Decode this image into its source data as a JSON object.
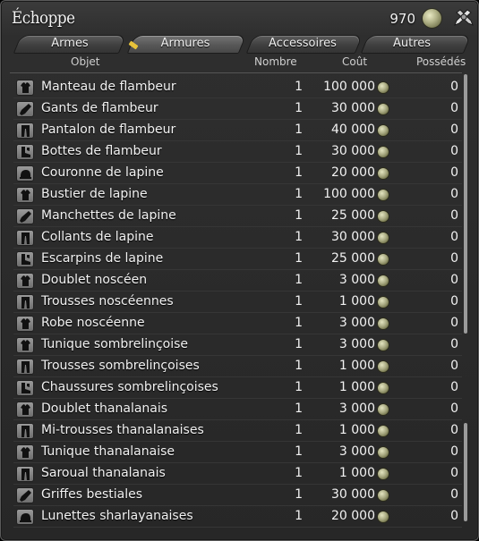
{
  "window": {
    "title": "Échoppe"
  },
  "currency": {
    "amount": "970",
    "icon": "gil-coin-icon"
  },
  "tabs": [
    {
      "label": "Armes",
      "active": false
    },
    {
      "label": "Armures",
      "active": true
    },
    {
      "label": "Accessoires",
      "active": false
    },
    {
      "label": "Autres",
      "active": false
    }
  ],
  "columns": {
    "object": "Objet",
    "quantity": "Nombre",
    "cost": "Coût",
    "owned": "Possédés"
  },
  "items": [
    {
      "icon": "body-armor-icon",
      "name": "Manteau de flambeur",
      "qty": "1",
      "cost": "100 000",
      "owned": "0"
    },
    {
      "icon": "gloves-icon",
      "name": "Gants de flambeur",
      "qty": "1",
      "cost": "30 000",
      "owned": "0"
    },
    {
      "icon": "legs-icon",
      "name": "Pantalon de flambeur",
      "qty": "1",
      "cost": "40 000",
      "owned": "0"
    },
    {
      "icon": "feet-icon",
      "name": "Bottes de flambeur",
      "qty": "1",
      "cost": "30 000",
      "owned": "0"
    },
    {
      "icon": "head-icon",
      "name": "Couronne de lapine",
      "qty": "1",
      "cost": "20 000",
      "owned": "0"
    },
    {
      "icon": "body-armor-icon",
      "name": "Bustier de lapine",
      "qty": "1",
      "cost": "100 000",
      "owned": "0"
    },
    {
      "icon": "gloves-icon",
      "name": "Manchettes de lapine",
      "qty": "1",
      "cost": "25 000",
      "owned": "0"
    },
    {
      "icon": "legs-icon",
      "name": "Collants de lapine",
      "qty": "1",
      "cost": "30 000",
      "owned": "0"
    },
    {
      "icon": "feet-icon",
      "name": "Escarpins de lapine",
      "qty": "1",
      "cost": "25 000",
      "owned": "0"
    },
    {
      "icon": "body-armor-icon",
      "name": "Doublet noscéen",
      "qty": "1",
      "cost": "3 000",
      "owned": "0"
    },
    {
      "icon": "legs-icon",
      "name": "Trousses noscéennes",
      "qty": "1",
      "cost": "1 000",
      "owned": "0"
    },
    {
      "icon": "body-armor-icon",
      "name": "Robe noscéenne",
      "qty": "1",
      "cost": "3 000",
      "owned": "0"
    },
    {
      "icon": "body-armor-icon",
      "name": "Tunique sombrelinçoise",
      "qty": "1",
      "cost": "3 000",
      "owned": "0"
    },
    {
      "icon": "legs-icon",
      "name": "Trousses sombrelinçoises",
      "qty": "1",
      "cost": "1 000",
      "owned": "0"
    },
    {
      "icon": "feet-icon",
      "name": "Chaussures sombrelinçoises",
      "qty": "1",
      "cost": "1 000",
      "owned": "0"
    },
    {
      "icon": "body-armor-icon",
      "name": "Doublet thanalanais",
      "qty": "1",
      "cost": "3 000",
      "owned": "0"
    },
    {
      "icon": "legs-icon",
      "name": "Mi-trousses thanalanaises",
      "qty": "1",
      "cost": "1 000",
      "owned": "0"
    },
    {
      "icon": "body-armor-icon",
      "name": "Tunique thanalanaise",
      "qty": "1",
      "cost": "3 000",
      "owned": "0"
    },
    {
      "icon": "legs-icon",
      "name": "Saroual thanalanais",
      "qty": "1",
      "cost": "1 000",
      "owned": "0"
    },
    {
      "icon": "gloves-icon",
      "name": "Griffes bestiales",
      "qty": "1",
      "cost": "30 000",
      "owned": "0"
    },
    {
      "icon": "head-icon",
      "name": "Lunettes sharlayanaises",
      "qty": "1",
      "cost": "20 000",
      "owned": "0"
    }
  ]
}
